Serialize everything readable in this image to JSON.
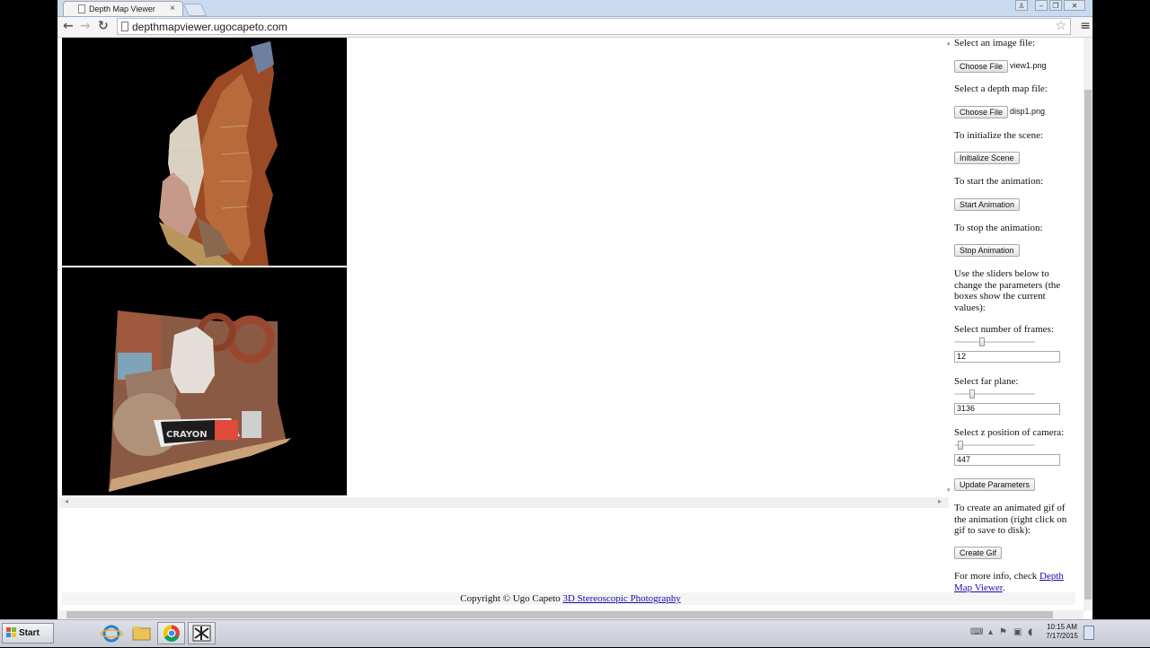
{
  "browser": {
    "tab_title": "Depth Map Viewer",
    "url": "depthmapviewer.ugocapeto.com"
  },
  "panel": {
    "select_image_label": "Select an image file:",
    "choose_file_label": "Choose File",
    "image_file_name": "view1.png",
    "select_depth_label": "Select a depth map file:",
    "depth_file_name": "disp1.png",
    "init_label": "To initialize the scene:",
    "init_button": "Initialize Scene",
    "start_label": "To start the animation:",
    "start_button": "Start Animation",
    "stop_label": "To stop the animation:",
    "stop_button": "Stop Animation",
    "sliders_intro": "Use the sliders below to change the parameters (the boxes show the current values):",
    "frames_label": "Select number of frames:",
    "frames_value": "12",
    "frames_level": 0.33,
    "far_label": "Select far plane:",
    "far_value": "3136",
    "far_level": 0.2,
    "camera_label": "Select z position of camera:",
    "camera_value": "447",
    "camera_level": 0.05,
    "update_button": "Update Parameters",
    "gif_label": "To create an animated gif of the animation (right click on gif to save to disk):",
    "gif_button": "Create Gif",
    "info_prefix": "For more info, check ",
    "info_link": "Depth Map Viewer",
    "info_suffix": "."
  },
  "footer": {
    "copyright": "Copyright © Ugo Capeto ",
    "link": "3D Stereoscopic Photography"
  },
  "taskbar": {
    "start_label": "Start",
    "clock_time": "10:15 AM",
    "clock_date": "7/17/2015"
  }
}
